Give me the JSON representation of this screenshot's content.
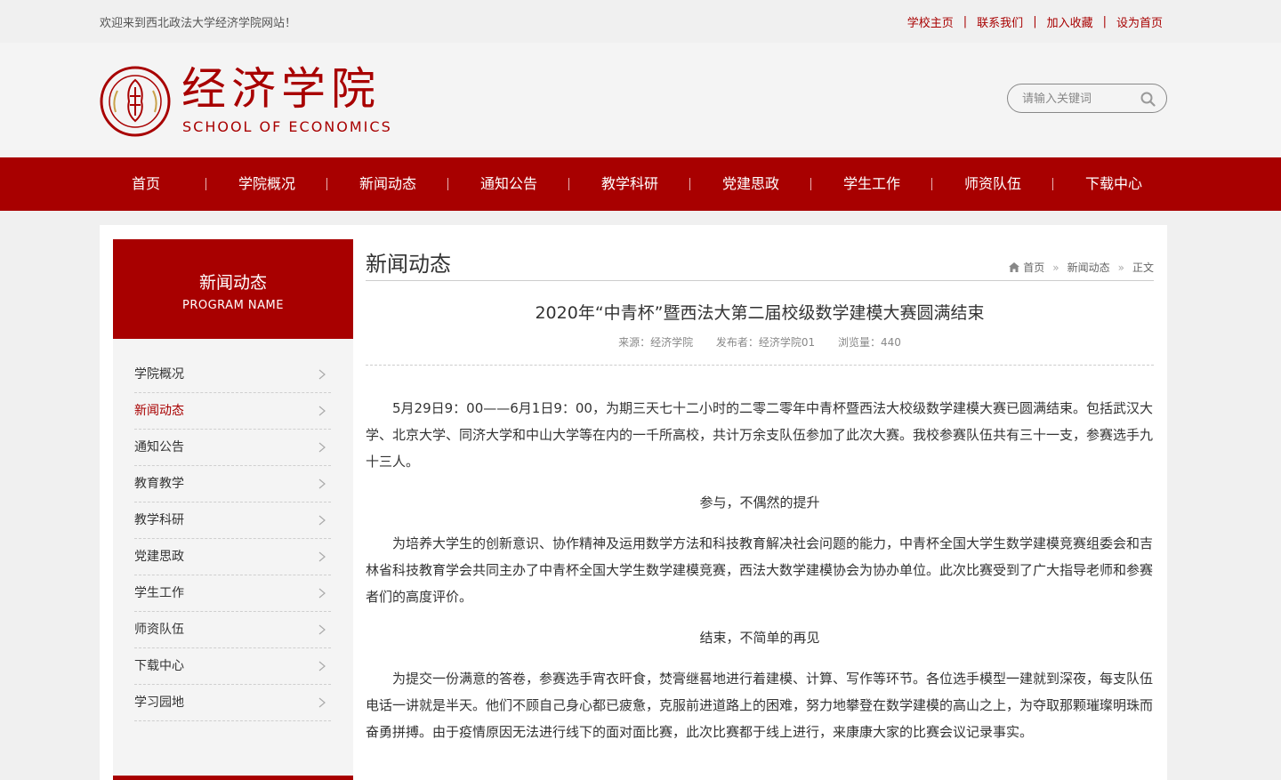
{
  "topbar": {
    "welcome": "欢迎来到西北政法大学经济学院网站！",
    "links": [
      "学校主页",
      "联系我们",
      "加入收藏",
      "设为首页"
    ]
  },
  "header": {
    "title_cn": "经济学院",
    "title_en": "SCHOOL OF ECONOMICS",
    "search_placeholder": "请输入关键词"
  },
  "nav": [
    "首页",
    "学院概况",
    "新闻动态",
    "通知公告",
    "教学科研",
    "党建思政",
    "学生工作",
    "师资队伍",
    "下载中心"
  ],
  "sidebar": {
    "title_cn": "新闻动态",
    "title_en": "PROGRAM NAME",
    "items": [
      "学院概况",
      "新闻动态",
      "通知公告",
      "教育教学",
      "教学科研",
      "党建思政",
      "学生工作",
      "师资队伍",
      "下载中心",
      "学习园地"
    ],
    "active_index": 1
  },
  "main": {
    "section_title": "新闻动态",
    "breadcrumb": [
      "首页",
      "新闻动态",
      "正文"
    ],
    "article": {
      "title": "2020年“中青杯”暨西法大第二届校级数学建模大赛圆满结束",
      "source": "来源：经济学院",
      "publisher": "发布者：经济学院01",
      "views": "浏览量：440",
      "paragraphs": [
        "5月29日9：00——6月1日9：00，为期三天七十二小时的二零二零年中青杯暨西法大校级数学建模大赛已圆满结束。包括武汉大学、北京大学、同济大学和中山大学等在内的一千所高校，共计万余支队伍参加了此次大赛。我校参赛队伍共有三十一支，参赛选手九十三人。",
        "参与，不偶然的提升",
        "为培养大学生的创新意识、协作精神及运用数学方法和科技教育解决社会问题的能力，中青杯全国大学生数学建模竞赛组委会和吉林省科技教育学会共同主办了中青杯全国大学生数学建模竞赛，西法大数学建模协会为协办单位。此次比赛受到了广大指导老师和参赛者们的高度评价。",
        "结束，不简单的再见",
        "为提交一份满意的答卷，参赛选手宵衣旰食，焚膏继晷地进行着建模、计算、写作等环节。各位选手模型一建就到深夜，每支队伍电话一讲就是半天。他们不顾自己身心都已疲惫，克服前进道路上的困难，努力地攀登在数学建模的高山之上，为夺取那颗璀璨明珠而奋勇拼搏。由于疫情原因无法进行线下的面对面比赛，此次比赛都于线上进行，来康康大家的比赛会议记录事实。"
      ]
    }
  },
  "colors": {
    "brand": "#a80000"
  }
}
